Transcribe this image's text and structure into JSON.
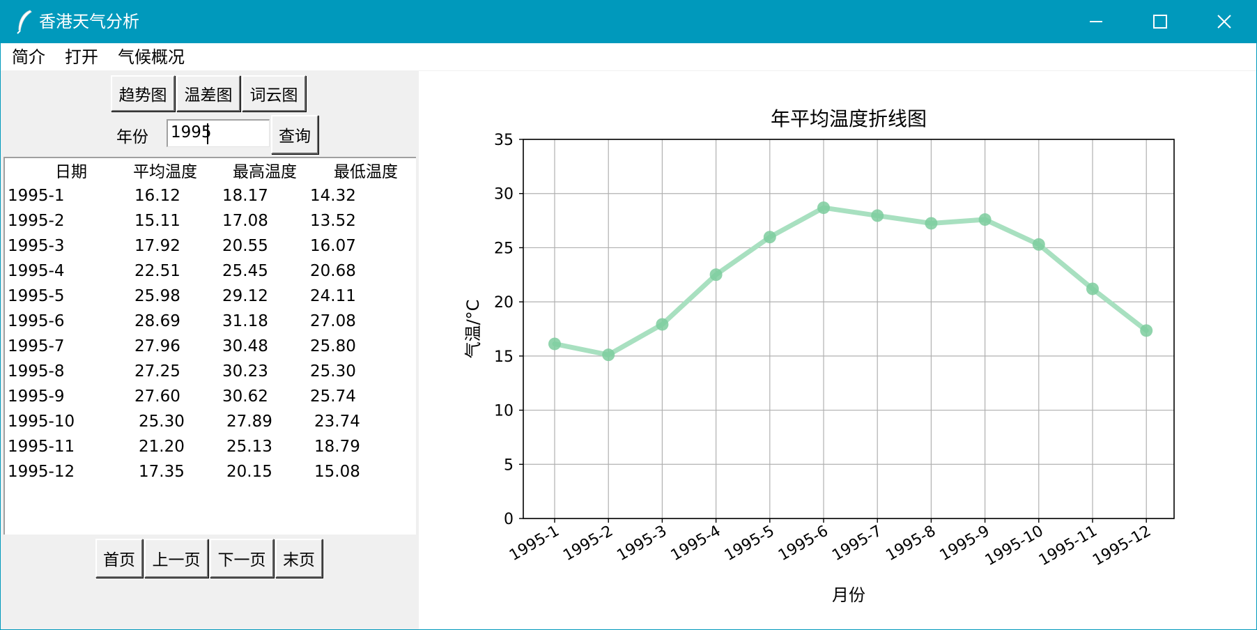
{
  "window": {
    "title": "香港天气分析",
    "icon": "feather-icon",
    "controls": [
      "minimize-icon",
      "maximize-icon",
      "close-icon"
    ]
  },
  "menu": [
    "简介",
    "打开",
    "气候概况"
  ],
  "toolbar": {
    "trend": "趋势图",
    "tempdiff": "温差图",
    "wordcloud": "词云图"
  },
  "query": {
    "label": "年份",
    "value": "1995",
    "button": "查询"
  },
  "table": {
    "headers": [
      "日期",
      "平均温度",
      "最高温度",
      "最低温度"
    ],
    "rows": [
      [
        "1995-1",
        "16.12",
        "18.17",
        "14.32"
      ],
      [
        "1995-2",
        "15.11",
        "17.08",
        "13.52"
      ],
      [
        "1995-3",
        "17.92",
        "20.55",
        "16.07"
      ],
      [
        "1995-4",
        "22.51",
        "25.45",
        "20.68"
      ],
      [
        "1995-5",
        "25.98",
        "29.12",
        "24.11"
      ],
      [
        "1995-6",
        "28.69",
        "31.18",
        "27.08"
      ],
      [
        "1995-7",
        "27.96",
        "30.48",
        "25.80"
      ],
      [
        "1995-8",
        "27.25",
        "30.23",
        "25.30"
      ],
      [
        "1995-9",
        "27.60",
        "30.62",
        "25.74"
      ],
      [
        "1995-10",
        "25.30",
        "27.89",
        "23.74"
      ],
      [
        "1995-11",
        "21.20",
        "25.13",
        "18.79"
      ],
      [
        "1995-12",
        "17.35",
        "20.15",
        "15.08"
      ]
    ]
  },
  "pager": {
    "first": "首页",
    "prev": "上一页",
    "next": "下一页",
    "last": "末页"
  },
  "colors": {
    "titlebar": "#0099bc",
    "line": "#a8e0c0",
    "marker": "#7ccc9e"
  },
  "chart_data": {
    "type": "line",
    "title": "年平均温度折线图",
    "xlabel": "月份",
    "ylabel": "气温/°C",
    "categories": [
      "1995-1",
      "1995-2",
      "1995-3",
      "1995-4",
      "1995-5",
      "1995-6",
      "1995-7",
      "1995-8",
      "1995-9",
      "1995-10",
      "1995-11",
      "1995-12"
    ],
    "values": [
      16.12,
      15.11,
      17.92,
      22.51,
      25.98,
      28.69,
      27.96,
      27.25,
      27.6,
      25.3,
      21.2,
      17.35
    ],
    "ylim": [
      0,
      35
    ],
    "yticks": [
      0,
      5,
      10,
      15,
      20,
      25,
      30,
      35
    ],
    "grid": true
  }
}
